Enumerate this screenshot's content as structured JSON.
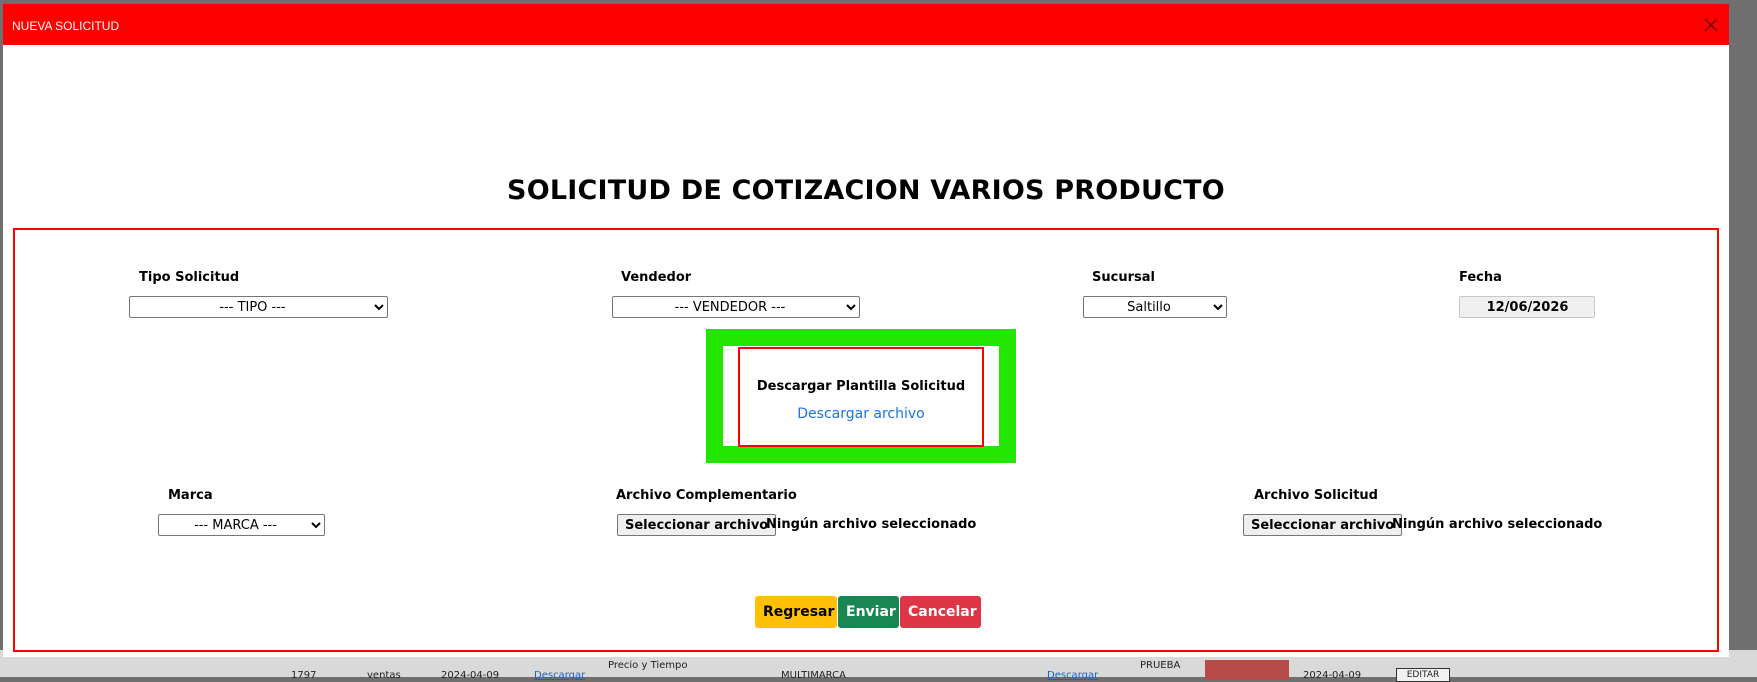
{
  "background_table": {
    "row_id": "1797",
    "user": "ventas",
    "date1": "2024-04-09",
    "link1": "Descargar",
    "type": "Precio y Tiempo",
    "brand": "MULTIMARCA",
    "link2": "Descargar",
    "note": "PRUEBA",
    "date2": "2024-04-09",
    "edit": "EDITAR"
  },
  "modal": {
    "header_title": "NUEVA SOLICITUD",
    "close_icon": "close-icon",
    "header_color": "#ff0000"
  },
  "form": {
    "title": "SOLICITUD DE COTIZACION VARIOS PRODUCTO",
    "tipo": {
      "label": "Tipo Solicitud",
      "value": "--- TIPO ---"
    },
    "vendedor": {
      "label": "Vendedor",
      "value": "--- VENDEDOR ---"
    },
    "sucursal": {
      "label": "Sucursal",
      "value": "Saltillo"
    },
    "fecha": {
      "label": "Fecha",
      "value": "12/06/2026"
    },
    "plantilla": {
      "label": "Descargar Plantilla Solicitud",
      "link": "Descargar archivo"
    },
    "marca": {
      "label": "Marca",
      "value": "--- MARCA ---"
    },
    "archivo_complementario": {
      "label": "Archivo Complementario",
      "button": "Seleccionar archivo",
      "status": "Ningún archivo seleccionado"
    },
    "archivo_solicitud": {
      "label": "Archivo Solicitud",
      "button": "Seleccionar archivo",
      "status": "Ningún archivo seleccionado"
    }
  },
  "actions": {
    "back": "Regresar",
    "send": "Enviar",
    "cancel": "Cancelar"
  },
  "colors": {
    "accent_red": "#ff0000",
    "highlight_green": "#22e600",
    "back_yellow": "#ffc107",
    "send_green": "#198754",
    "cancel_red": "#dc3545"
  }
}
